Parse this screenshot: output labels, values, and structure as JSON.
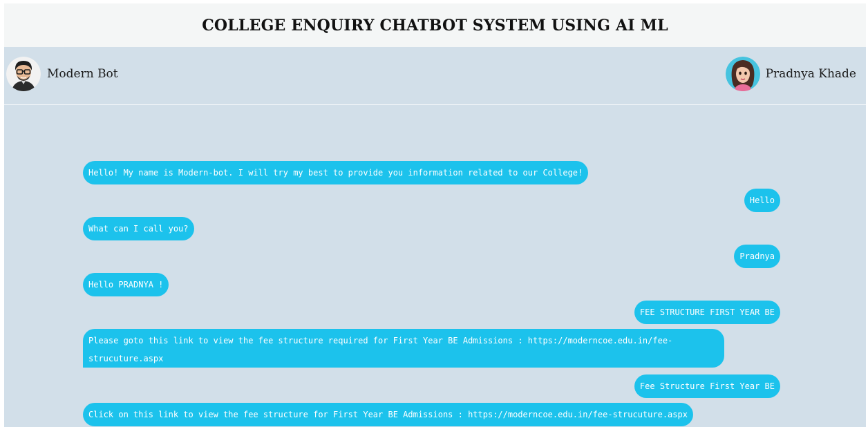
{
  "header": {
    "title": "COLLEGE ENQUIRY CHATBOT SYSTEM USING AI ML"
  },
  "participants": {
    "bot": {
      "name": "Modern Bot",
      "avatar_icon": "bot-avatar-icon"
    },
    "user": {
      "name": "Pradnya Khade",
      "avatar_icon": "user-avatar-icon"
    }
  },
  "colors": {
    "chat_background": "#d2dfe9",
    "header_background": "#f4f6f6",
    "bubble": "#1cc2ec",
    "bubble_text": "#ffffff"
  },
  "messages": [
    {
      "sender": "bot",
      "text": "Hello! My name is Modern-bot. I will try my best to provide you information related to our College!"
    },
    {
      "sender": "user",
      "text": "Hello"
    },
    {
      "sender": "bot",
      "text": "What can I call you?"
    },
    {
      "sender": "user",
      "text": "Pradnya"
    },
    {
      "sender": "bot",
      "text": "Hello PRADNYA !"
    },
    {
      "sender": "user",
      "text": "FEE STRUCTURE FIRST YEAR BE"
    },
    {
      "sender": "bot",
      "text": "Please goto this link to view the fee structure required for First Year BE Admissions : https://moderncoe.edu.in/fee-strucuture.aspx"
    },
    {
      "sender": "user",
      "text": "Fee Structure First Year BE"
    },
    {
      "sender": "bot",
      "text": "Click on this link to view the fee structure for First Year BE Admissions : https://moderncoe.edu.in/fee-strucuture.aspx"
    }
  ]
}
